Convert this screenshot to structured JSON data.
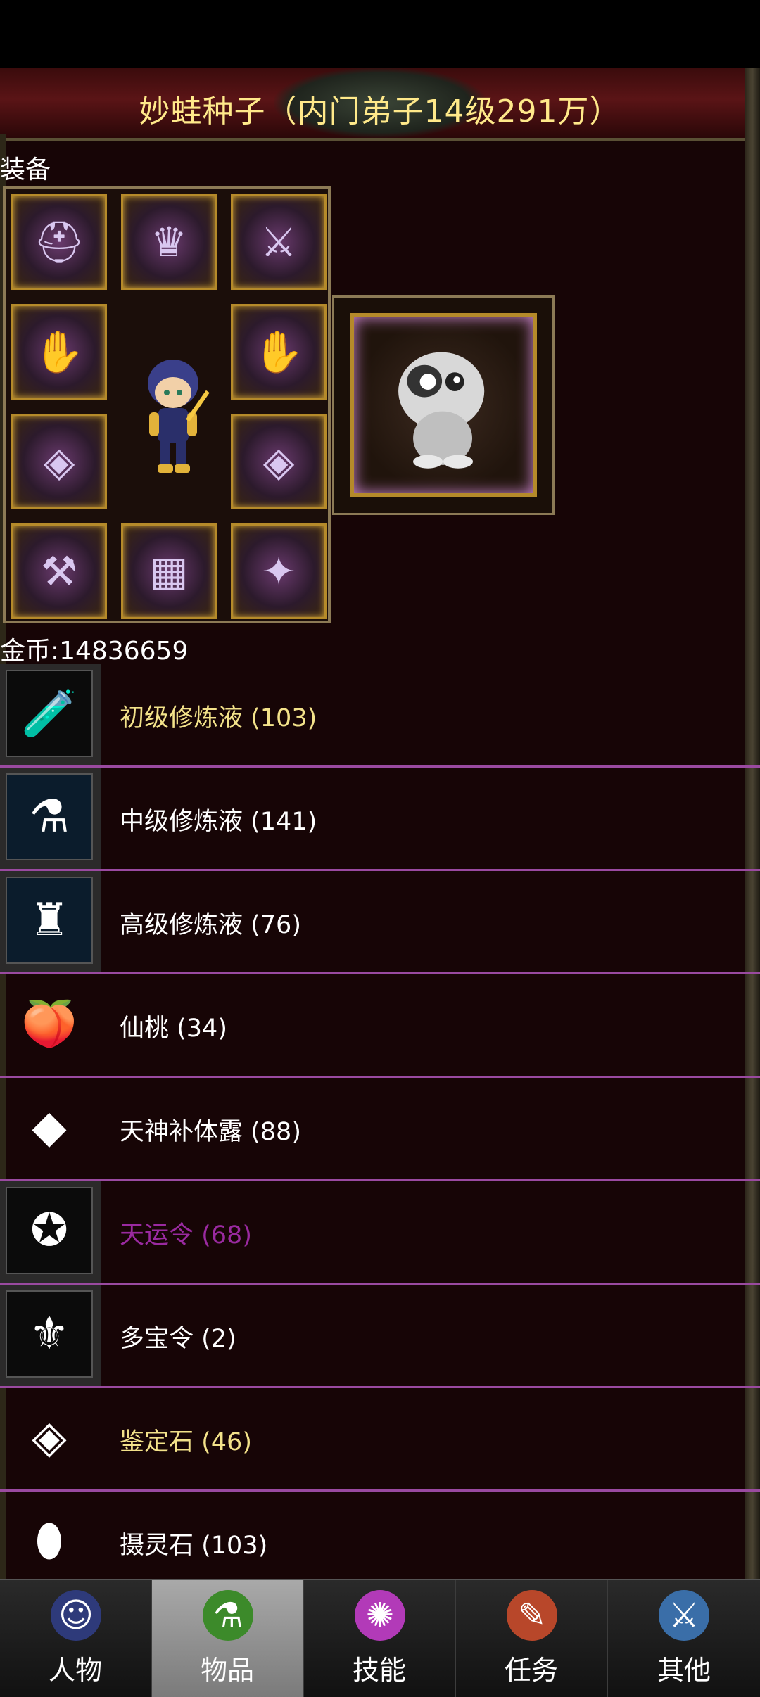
{
  "title": "妙蛙种子（内门弟子14级291万）",
  "equipment": {
    "section_label": "装备"
  },
  "gold": {
    "label": "金币:14836659"
  },
  "items": [
    {
      "label": "初级修炼液 (103)",
      "color": "#f3e28a",
      "icon": "blue-vial-icon"
    },
    {
      "label": "中级修炼液 (141)",
      "color": "#ffffff",
      "icon": "potion-flask-icon"
    },
    {
      "label": "高级修炼液 (76)",
      "color": "#ffffff",
      "icon": "winged-bottle-icon"
    },
    {
      "label": "仙桃 (34)",
      "color": "#ffffff",
      "icon": "peach-icon"
    },
    {
      "label": "天神补体露 (88)",
      "color": "#ffffff",
      "icon": "diamond-potion-icon"
    },
    {
      "label": "天运令 (68)",
      "color": "#9a2aa0",
      "icon": "fortune-token-icon"
    },
    {
      "label": "多宝令 (2)",
      "color": "#ffffff",
      "icon": "treasure-token-icon"
    },
    {
      "label": "鉴定石 (46)",
      "color": "#f3e28a",
      "icon": "rainbow-gem-icon"
    },
    {
      "label": "摄灵石 (103)",
      "color": "#ffffff",
      "icon": "spirit-egg-icon"
    }
  ],
  "nav": {
    "tabs": [
      {
        "label": "人物",
        "icon": "character-icon",
        "active": false
      },
      {
        "label": "物品",
        "icon": "items-potion-icon",
        "active": true
      },
      {
        "label": "技能",
        "icon": "skill-orb-icon",
        "active": false
      },
      {
        "label": "任务",
        "icon": "quest-scroll-icon",
        "active": false
      },
      {
        "label": "其他",
        "icon": "other-sword-icon",
        "active": false
      }
    ]
  }
}
